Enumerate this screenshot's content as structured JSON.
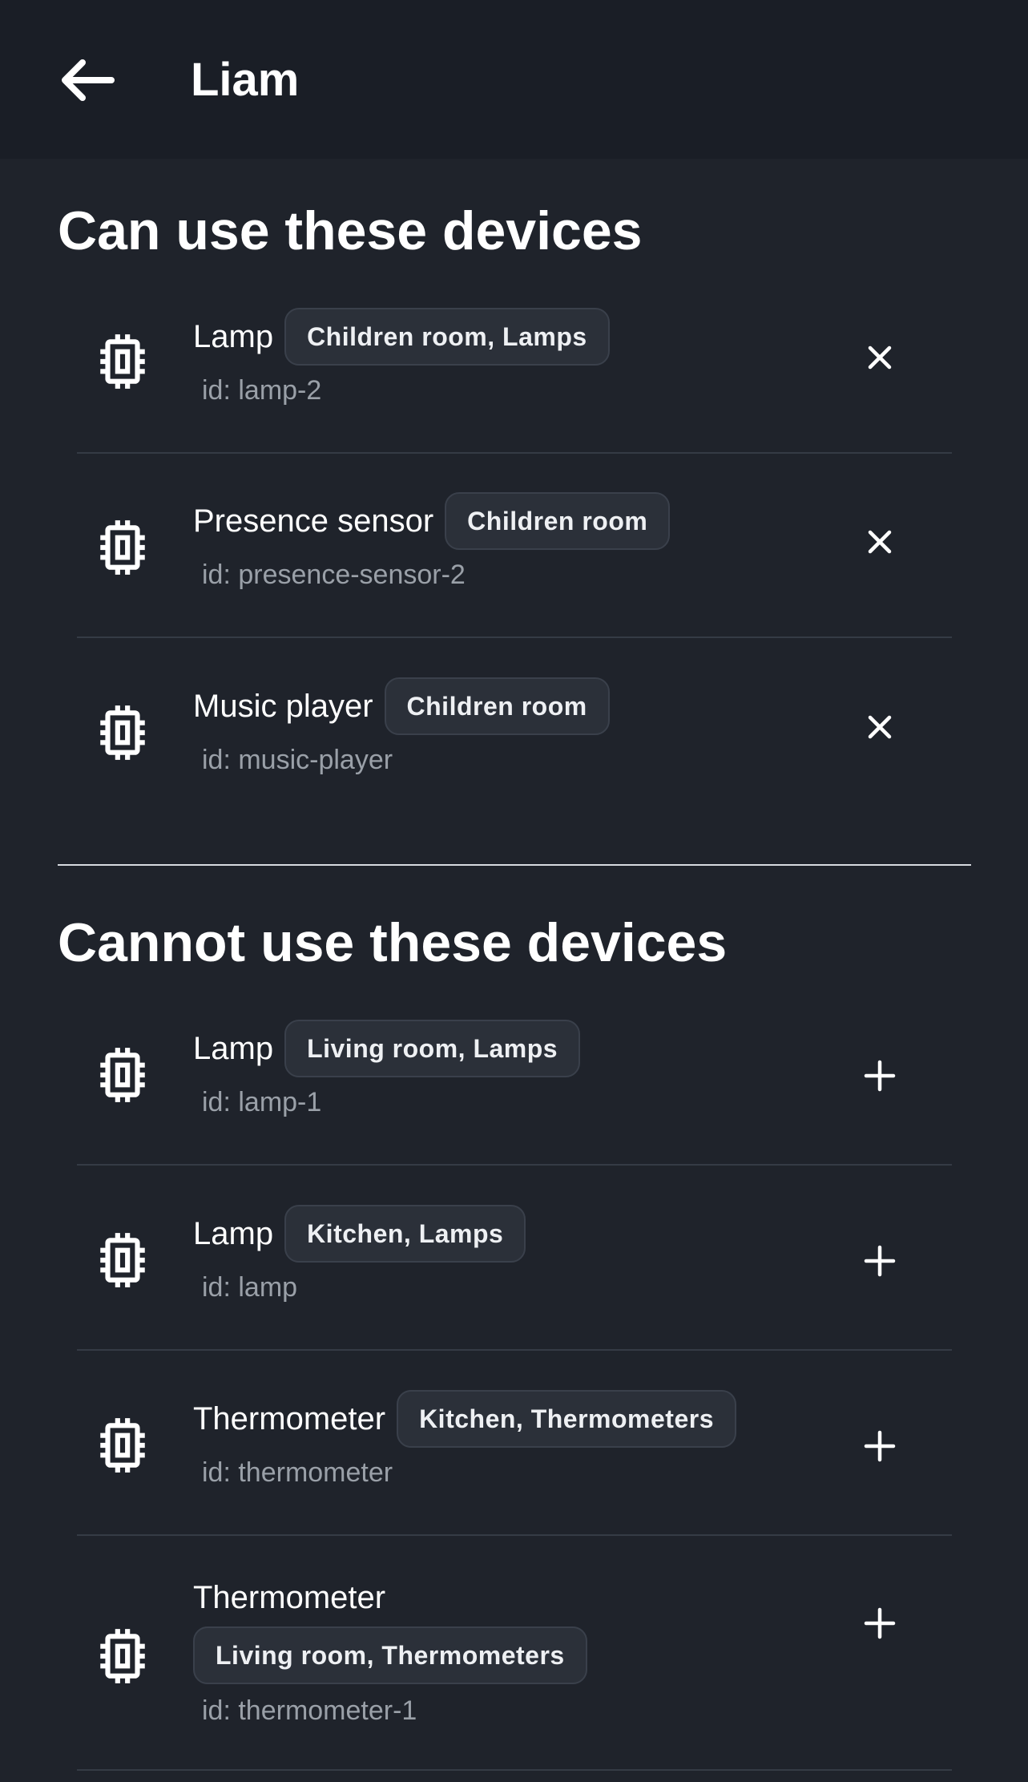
{
  "header": {
    "title": "Liam"
  },
  "can_use": {
    "title": "Can use these devices",
    "devices": [
      {
        "name": "Lamp",
        "tag": "Children room, Lamps",
        "id_text": "id: lamp-2"
      },
      {
        "name": "Presence sensor",
        "tag": "Children room",
        "id_text": "id: presence-sensor-2"
      },
      {
        "name": "Music player",
        "tag": "Children room",
        "id_text": "id: music-player"
      }
    ]
  },
  "cannot_use": {
    "title": "Cannot use these devices",
    "devices": [
      {
        "name": "Lamp",
        "tag": "Living room, Lamps",
        "id_text": "id: lamp-1"
      },
      {
        "name": "Lamp",
        "tag": "Kitchen, Lamps",
        "id_text": "id: lamp"
      },
      {
        "name": "Thermometer",
        "tag": "Kitchen, Thermometers",
        "id_text": "id: thermometer"
      },
      {
        "name": "Thermometer",
        "tag": "Living room, Thermometers",
        "id_text": "id: thermometer-1"
      }
    ]
  }
}
